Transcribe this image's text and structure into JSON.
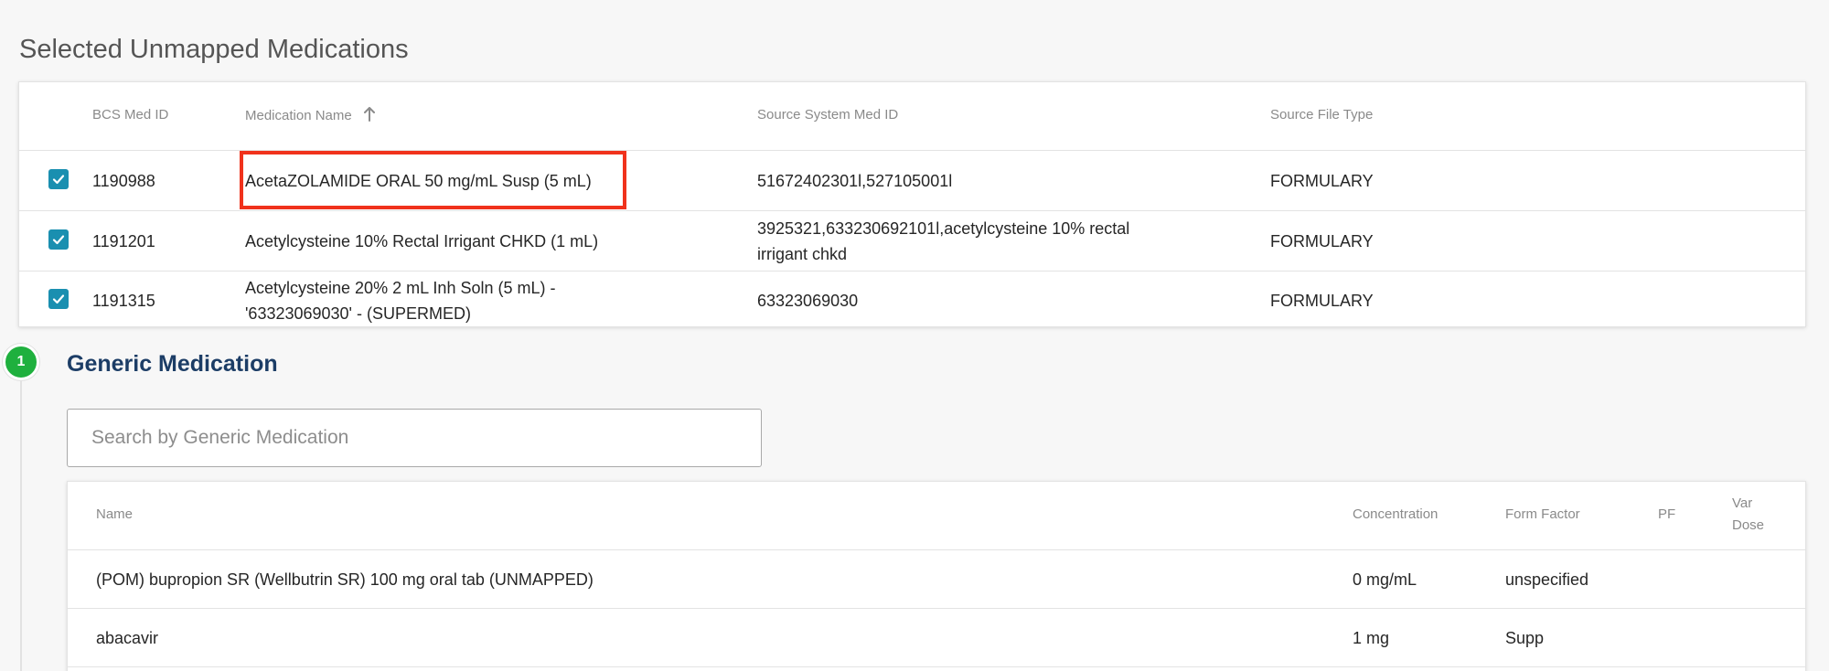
{
  "selected": {
    "title": "Selected Unmapped Medications",
    "columns": {
      "bcs_med_id": "BCS Med ID",
      "medication_name": "Medication Name",
      "source_system_med_id": "Source System Med ID",
      "source_file_type": "Source File Type"
    },
    "rows": [
      {
        "checked": true,
        "id": "1190988",
        "name_line1": "AcetaZOLAMIDE ORAL 50 mg/mL Susp (5 mL)",
        "name_line2": "",
        "source_line1": "51672402301l,527105001l",
        "source_line2": "",
        "type": "FORMULARY"
      },
      {
        "checked": true,
        "id": "1191201",
        "name_line1": "Acetylcysteine 10% Rectal Irrigant CHKD (1 mL)",
        "name_line2": "",
        "source_line1": "3925321,633230692101l,acetylcysteine 10% rectal",
        "source_line2": "irrigant chkd",
        "type": "FORMULARY"
      },
      {
        "checked": true,
        "id": "1191315",
        "name_line1": "Acetylcysteine 20% 2 mL Inh Soln (5 mL) -",
        "name_line2": "'63323069030' - (SUPERMED)",
        "source_line1": "63323069030",
        "source_line2": "",
        "type": "FORMULARY"
      }
    ]
  },
  "generic": {
    "step_number": "1",
    "title": "Generic Medication",
    "search_placeholder": "Search by Generic Medication",
    "columns": {
      "name": "Name",
      "concentration": "Concentration",
      "form_factor": "Form Factor",
      "pf": "PF",
      "var_dose_line1": "Var",
      "var_dose_line2": "Dose"
    },
    "rows": [
      {
        "name": "(POM) bupropion SR (Wellbutrin SR) 100 mg oral tab (UNMAPPED)",
        "concentration": "0 mg/mL",
        "form_factor": "unspecified"
      },
      {
        "name": "abacavir",
        "concentration": "1 mg",
        "form_factor": "Supp"
      }
    ]
  },
  "colors": {
    "checkbox": "#1a8fb0",
    "highlight": "#f0321c",
    "step_badge": "#1fb03e",
    "generic_title": "#1c3d66"
  }
}
